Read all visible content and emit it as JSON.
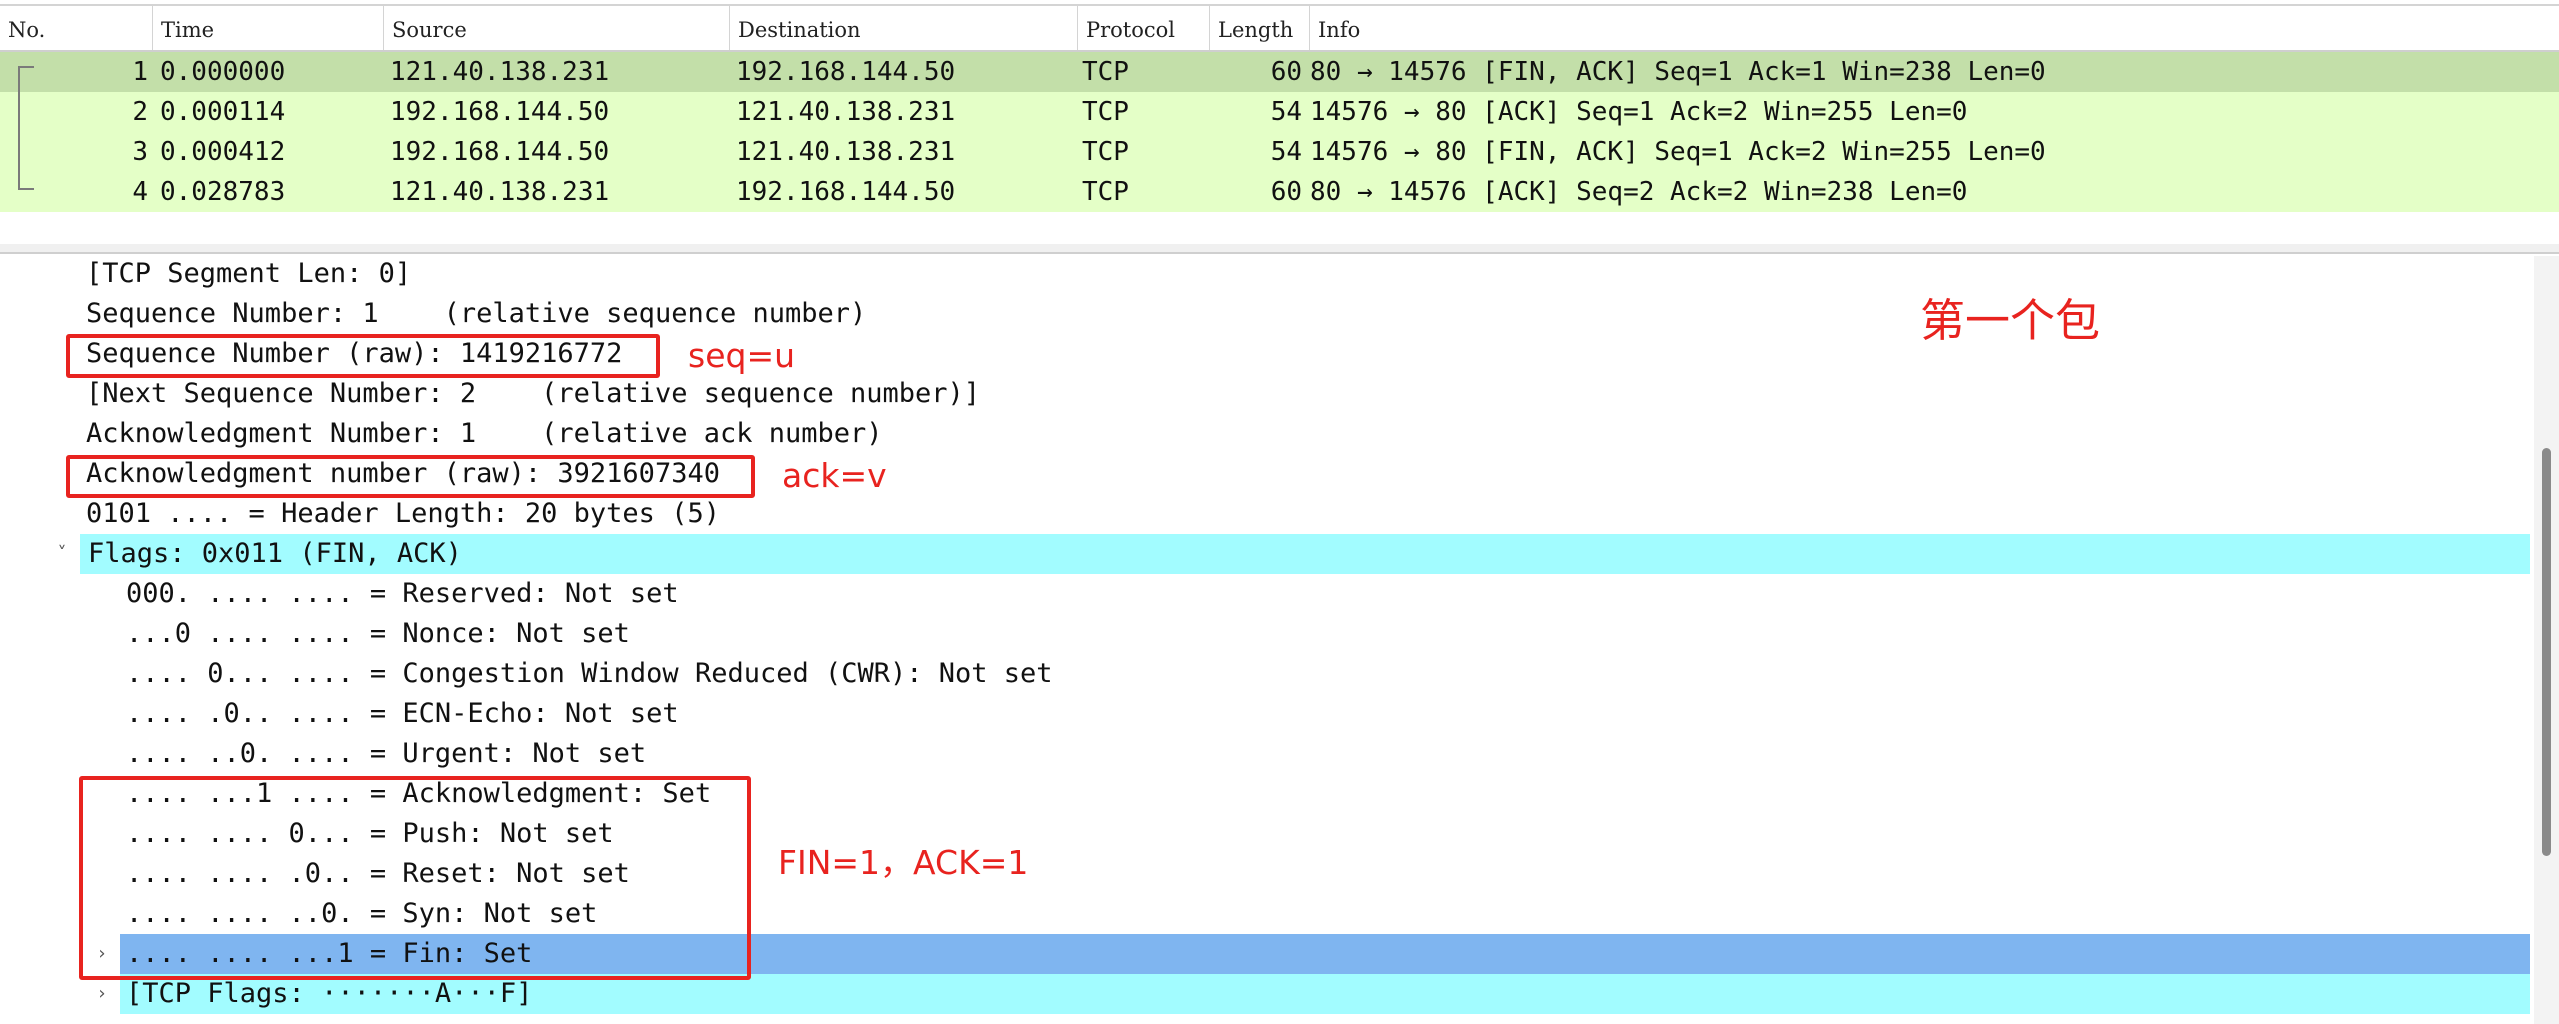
{
  "packet_list": {
    "columns": [
      "No.",
      "Time",
      "Source",
      "Destination",
      "Protocol",
      "Length",
      "Info"
    ],
    "rows": [
      {
        "no": "1",
        "time": "0.000000",
        "source": "121.40.138.231",
        "destination": "192.168.144.50",
        "protocol": "TCP",
        "length": "60",
        "info": "80 → 14576 [FIN, ACK] Seq=1 Ack=1 Win=238 Len=0",
        "bg": "#c3dfa9"
      },
      {
        "no": "2",
        "time": "0.000114",
        "source": "192.168.144.50",
        "destination": "121.40.138.231",
        "protocol": "TCP",
        "length": "54",
        "info": "14576 → 80 [ACK] Seq=1 Ack=2 Win=255 Len=0",
        "bg": "#e4ffc7"
      },
      {
        "no": "3",
        "time": "0.000412",
        "source": "192.168.144.50",
        "destination": "121.40.138.231",
        "protocol": "TCP",
        "length": "54",
        "info": "14576 → 80 [FIN, ACK] Seq=1 Ack=2 Win=255 Len=0",
        "bg": "#e4ffc7"
      },
      {
        "no": "4",
        "time": "0.028783",
        "source": "121.40.138.231",
        "destination": "192.168.144.50",
        "protocol": "TCP",
        "length": "60",
        "info": "80 → 14576 [ACK] Seq=2 Ack=2 Win=238 Len=0",
        "bg": "#e4ffc7"
      }
    ]
  },
  "details": {
    "lines": [
      {
        "text": "[TCP Segment Len: 0]"
      },
      {
        "text": "Sequence Number: 1    (relative sequence number)"
      },
      {
        "text": "Sequence Number (raw): 1419216772"
      },
      {
        "text": "[Next Sequence Number: 2    (relative sequence number)]"
      },
      {
        "text": "Acknowledgment Number: 1    (relative ack number)"
      },
      {
        "text": "Acknowledgment number (raw): 3921607340"
      },
      {
        "text": "0101 .... = Header Length: 20 bytes (5)"
      },
      {
        "text": "Flags: 0x011 (FIN, ACK)",
        "toggle": "expanded",
        "highlight": "cyan"
      },
      {
        "text": "000. .... .... = Reserved: Not set"
      },
      {
        "text": "...0 .... .... = Nonce: Not set"
      },
      {
        "text": ".... 0... .... = Congestion Window Reduced (CWR): Not set"
      },
      {
        "text": ".... .0.. .... = ECN-Echo: Not set"
      },
      {
        "text": ".... ..0. .... = Urgent: Not set"
      },
      {
        "text": ".... ...1 .... = Acknowledgment: Set"
      },
      {
        "text": ".... .... 0... = Push: Not set"
      },
      {
        "text": ".... .... .0.. = Reset: Not set"
      },
      {
        "text": ".... .... ..0. = Syn: Not set"
      },
      {
        "text": ".... .... ...1 = Fin: Set",
        "toggle": "collapsed",
        "highlight": "blue",
        "selected": true
      },
      {
        "text": "[TCP Flags: ·······A···F]",
        "toggle": "collapsed",
        "highlight": "cyan"
      }
    ]
  },
  "annotations": {
    "title": "第一个包",
    "seq_note": "seq=u",
    "ack_note": "ack=v",
    "flags_note": "FIN=1，ACK=1",
    "color": "#e8231f"
  },
  "icons": {
    "expanded": "chevron-down-icon",
    "collapsed": "chevron-right-icon"
  }
}
